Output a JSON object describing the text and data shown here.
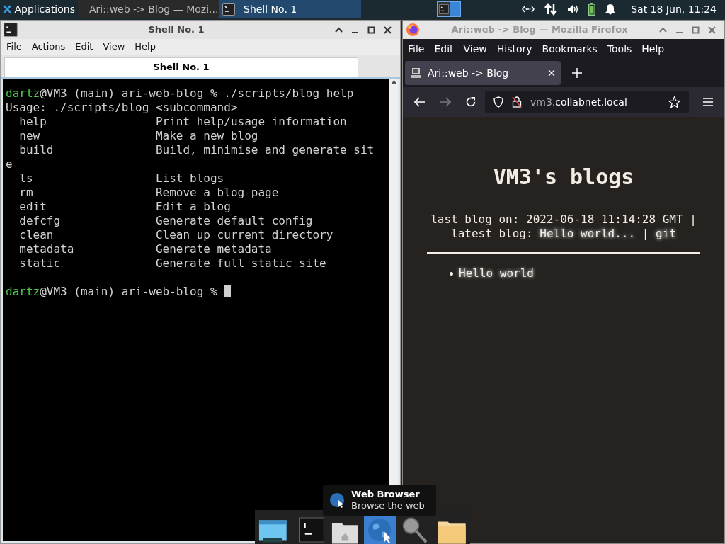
{
  "top_panel": {
    "applications": "Applications",
    "tasks": [
      {
        "kind": "firefox",
        "label": "Ari::web -> Blog — Mozi...",
        "selected": false
      },
      {
        "kind": "terminal",
        "label": "Shell No. 1",
        "selected": true
      }
    ],
    "clock": "Sat 18 Jun, 11:24"
  },
  "terminal": {
    "title": "Shell No. 1",
    "menu": [
      "File",
      "Actions",
      "Edit",
      "View",
      "Help"
    ],
    "tab": "Shell No. 1",
    "lines": [
      {
        "kind": "prompt",
        "user": "dartz",
        "text": "@VM3 (main) ari-web-blog % ./scripts/blog help",
        "cursor": false
      },
      {
        "kind": "output",
        "text": "Usage: ./scripts/blog <subcommand>"
      },
      {
        "kind": "output",
        "text": "  help                Print help/usage information"
      },
      {
        "kind": "output",
        "text": "  new                 Make a new blog"
      },
      {
        "kind": "output",
        "text": "  build               Build, minimise and generate sit"
      },
      {
        "kind": "output",
        "text": "e"
      },
      {
        "kind": "output",
        "text": "  ls                  List blogs"
      },
      {
        "kind": "output",
        "text": "  rm                  Remove a blog page"
      },
      {
        "kind": "output",
        "text": "  edit                Edit a blog"
      },
      {
        "kind": "output",
        "text": "  defcfg              Generate default config"
      },
      {
        "kind": "output",
        "text": "  clean               Clean up current directory"
      },
      {
        "kind": "output",
        "text": "  metadata            Generate metadata"
      },
      {
        "kind": "output",
        "text": "  static              Generate full static site"
      },
      {
        "kind": "blank"
      },
      {
        "kind": "prompt",
        "user": "dartz",
        "text": "@VM3 (main) ari-web-blog % ",
        "cursor": true
      }
    ]
  },
  "browser": {
    "title": "Ari::web -> Blog — Mozilla Firefox",
    "menu": [
      "File",
      "Edit",
      "View",
      "History",
      "Bookmarks",
      "Tools",
      "Help"
    ],
    "tab": "Ari::web -> Blog",
    "url_host": "vm3.",
    "url_rest": "collabnet.local",
    "page": {
      "heading": "VM3's blogs",
      "meta_text": "last blog on: 2022-06-18 11:14:28 GMT |",
      "latest_label": "latest blog:",
      "latest_link": "Hello world...",
      "separator": "|",
      "git_link": "git",
      "posts": [
        "Hello world"
      ]
    }
  },
  "tooltip": {
    "title": "Web Browser",
    "subtitle": "Browse the web"
  }
}
